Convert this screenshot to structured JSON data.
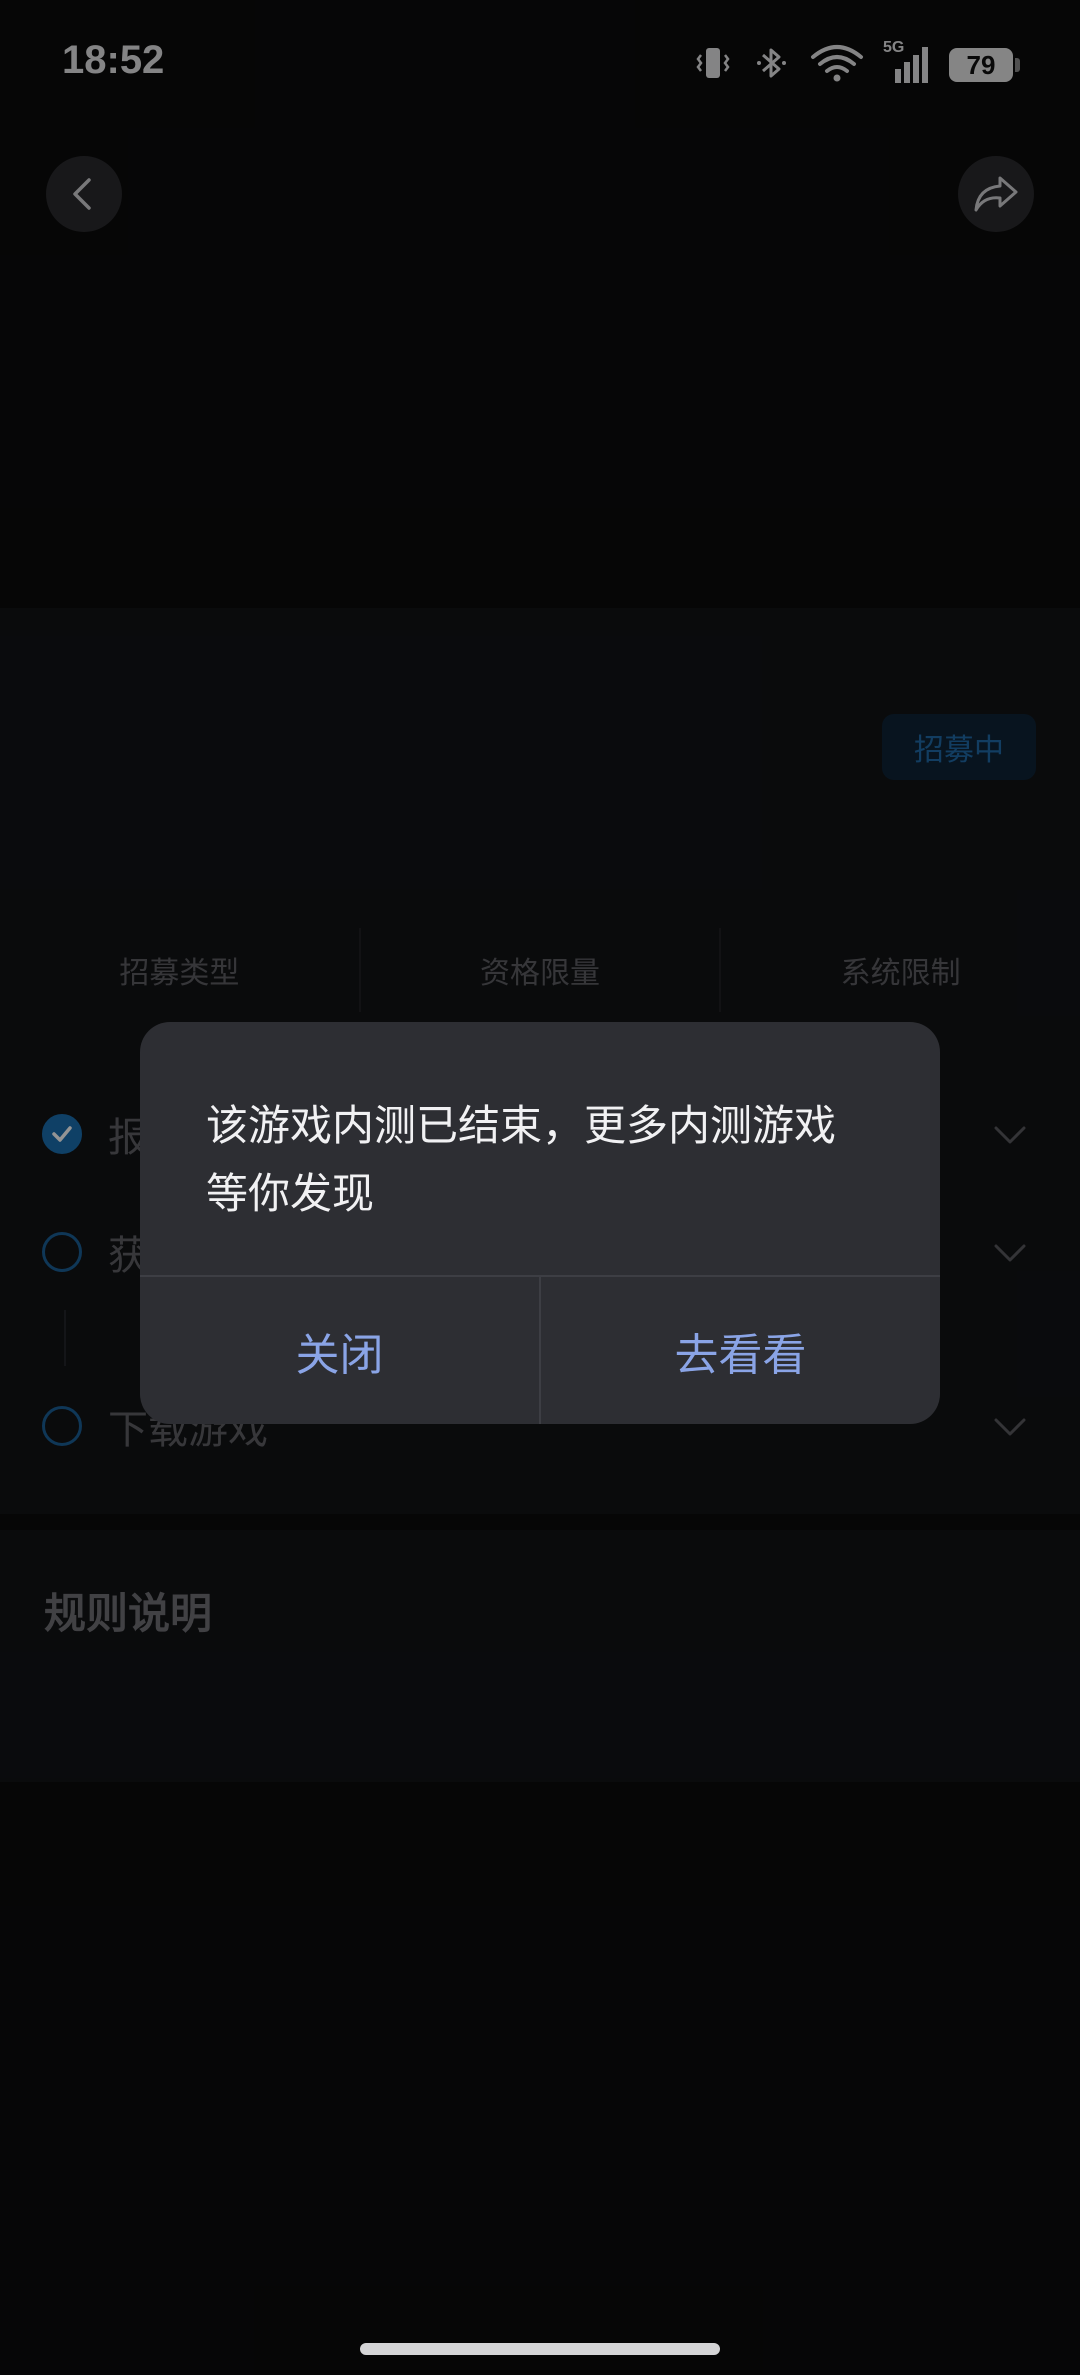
{
  "status_bar": {
    "time": "18:52",
    "network": "5G",
    "battery": "79",
    "icons": [
      "vibrate-icon",
      "bluetooth-icon",
      "wifi-icon",
      "signal-icon",
      "battery-icon"
    ]
  },
  "nav": {
    "back_icon": "chevron-left-icon",
    "share_icon": "share-icon"
  },
  "info_card": {
    "status_badge": "招募中",
    "stats": [
      {
        "label": "招募类型"
      },
      {
        "label": "资格限量"
      },
      {
        "label": "系统限制"
      }
    ],
    "steps": [
      {
        "label": "报",
        "done": true
      },
      {
        "label": "获",
        "done": false
      },
      {
        "label": "下载游戏",
        "done": false
      }
    ]
  },
  "rules": {
    "title": "规则说明"
  },
  "dialog": {
    "message": "该游戏内测已结束，更多内测游戏等你发现",
    "close_label": "关闭",
    "go_label": "去看看"
  },
  "colors": {
    "accent": "#1b6fb0",
    "dialog_button": "#8aa4e6",
    "dialog_bg": "#2d2e33",
    "page_bg": "#0b0b0c"
  }
}
